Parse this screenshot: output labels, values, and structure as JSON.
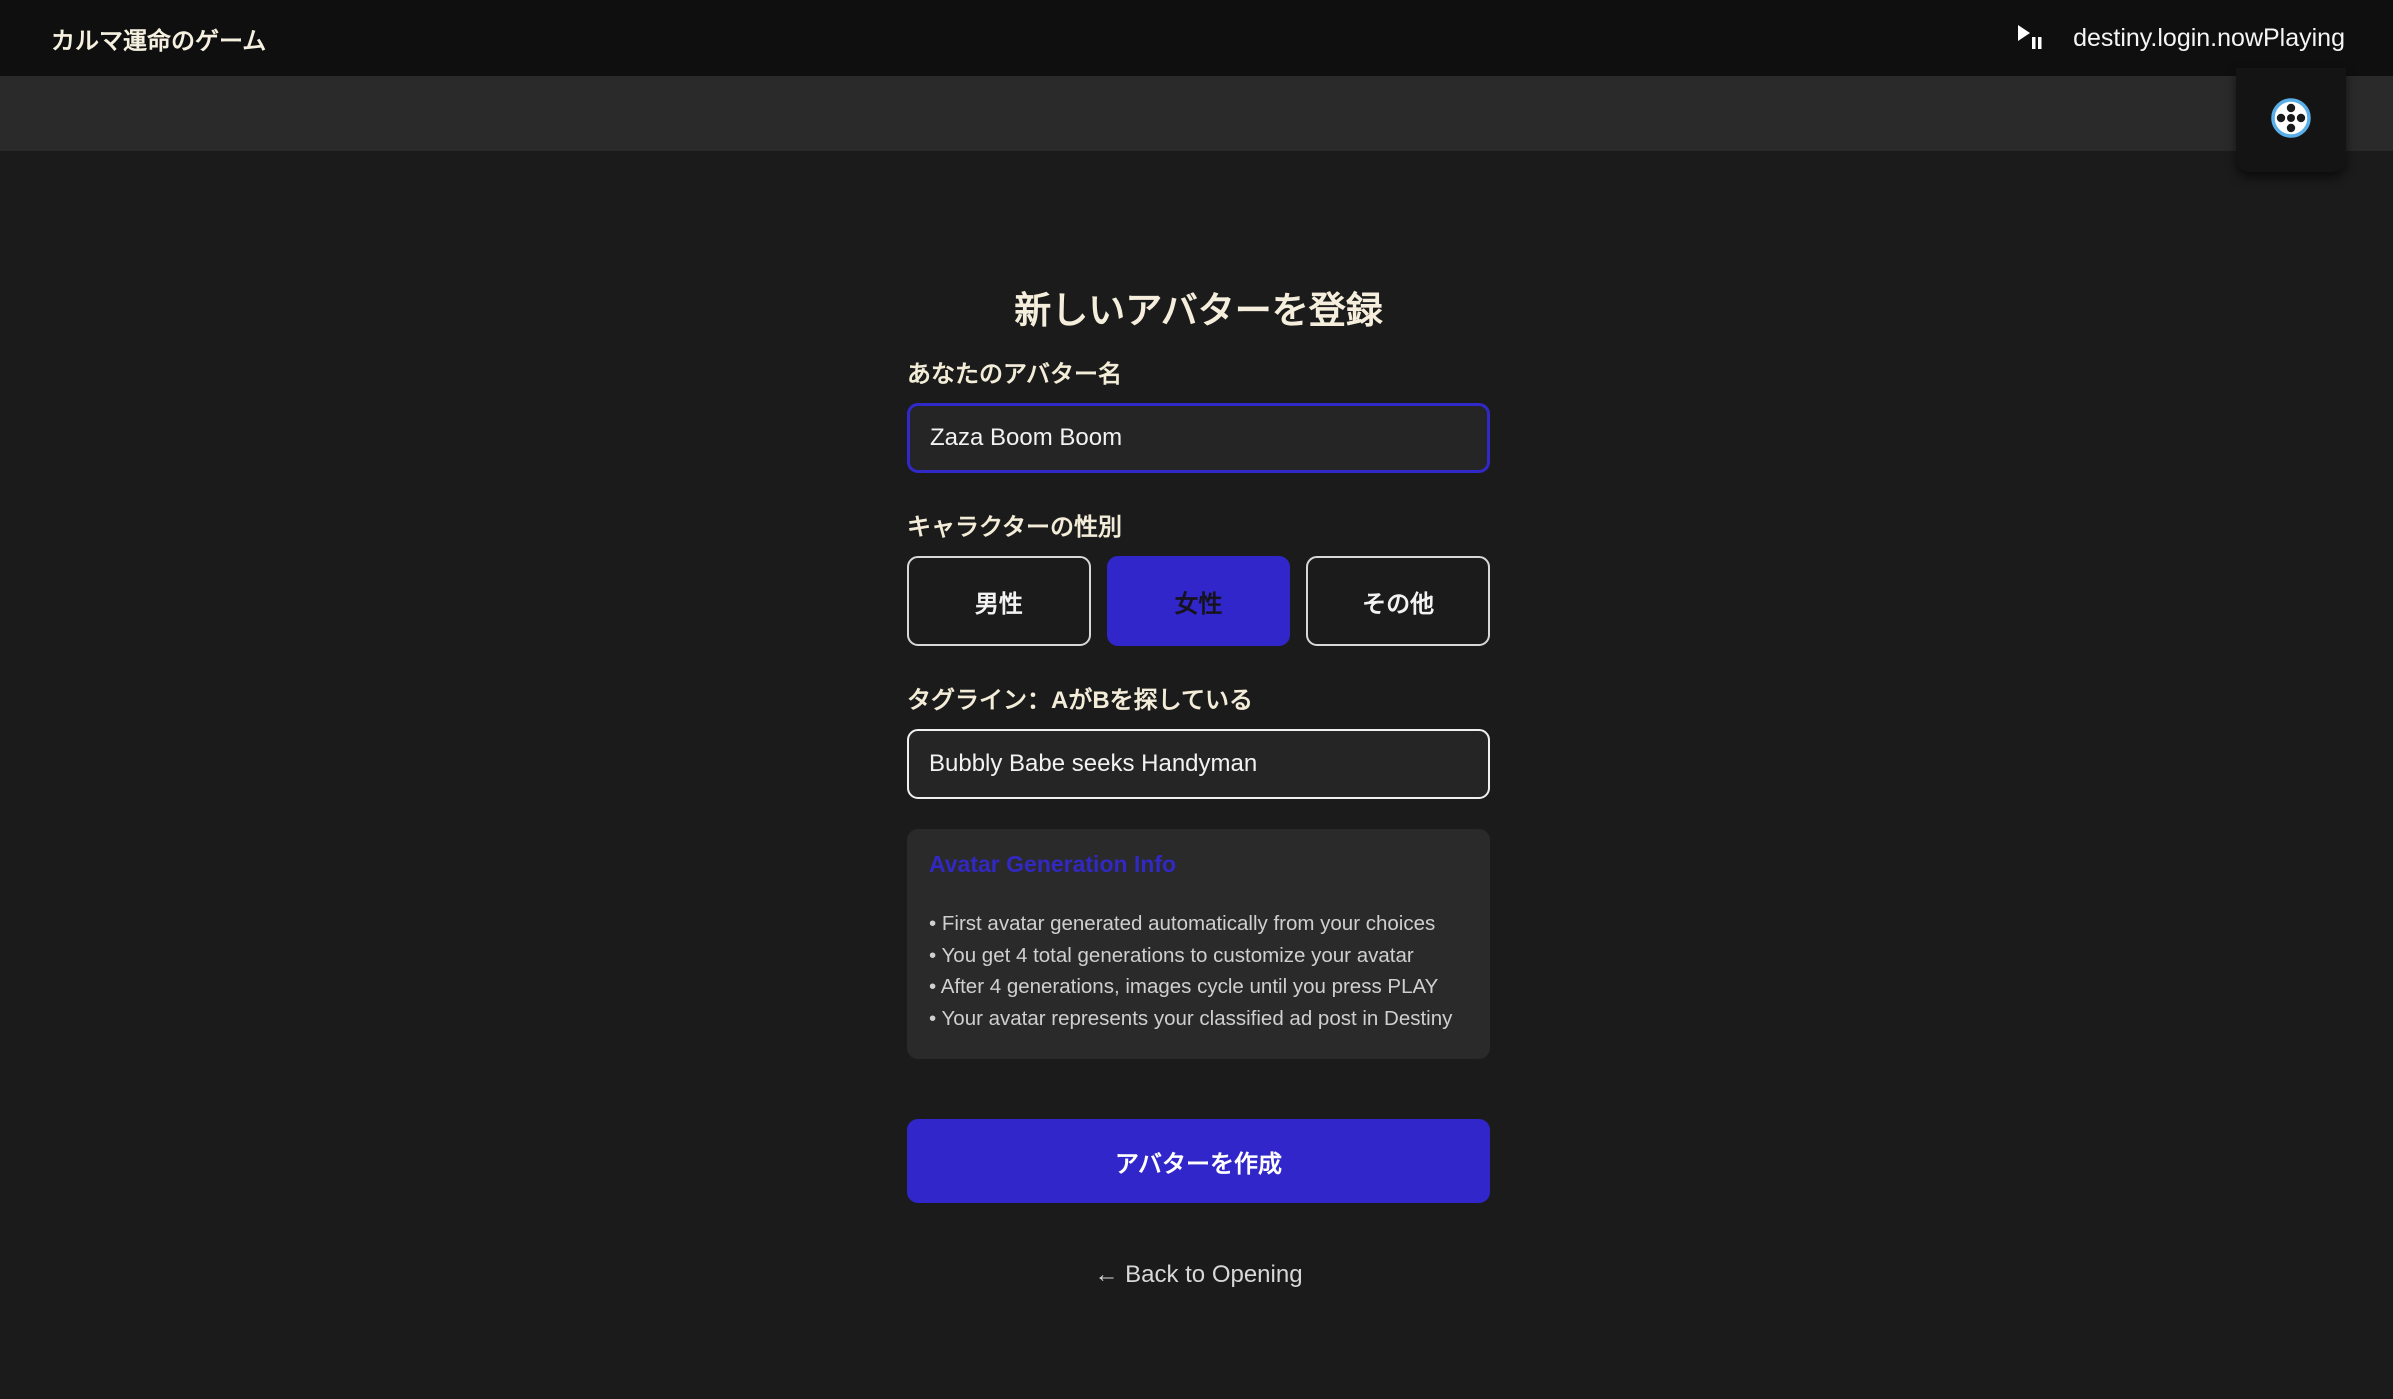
{
  "header": {
    "app_title": "カルマ運命のゲーム",
    "now_playing": "destiny.login.nowPlaying",
    "play_pause_icon": "play-pause-icon",
    "settings_icon": "film-reel-icon"
  },
  "form": {
    "title": "新しいアバターを登録",
    "name_label": "あなたのアバター名",
    "name_value": "Zaza Boom Boom",
    "gender_label": "キャラクターの性別",
    "gender_options": [
      "男性",
      "女性",
      "その他"
    ],
    "gender_selected": "女性",
    "tagline_label": "タグライン：AがBを探している",
    "tagline_value": "Bubbly Babe seeks Handyman",
    "create_label": "アバターを作成",
    "back_label": "← Back to Opening"
  },
  "info": {
    "title": "Avatar Generation Info",
    "items": [
      "• First avatar generated automatically from your choices",
      "• You get 4 total generations to customize your avatar",
      "• After 4 generations, images cycle until you press PLAY",
      "• Your avatar represents your classified ad post in Destiny"
    ]
  },
  "colors": {
    "accent": "#3026c9",
    "background": "#1b1b1b",
    "topbar": "#0f0f0f"
  }
}
